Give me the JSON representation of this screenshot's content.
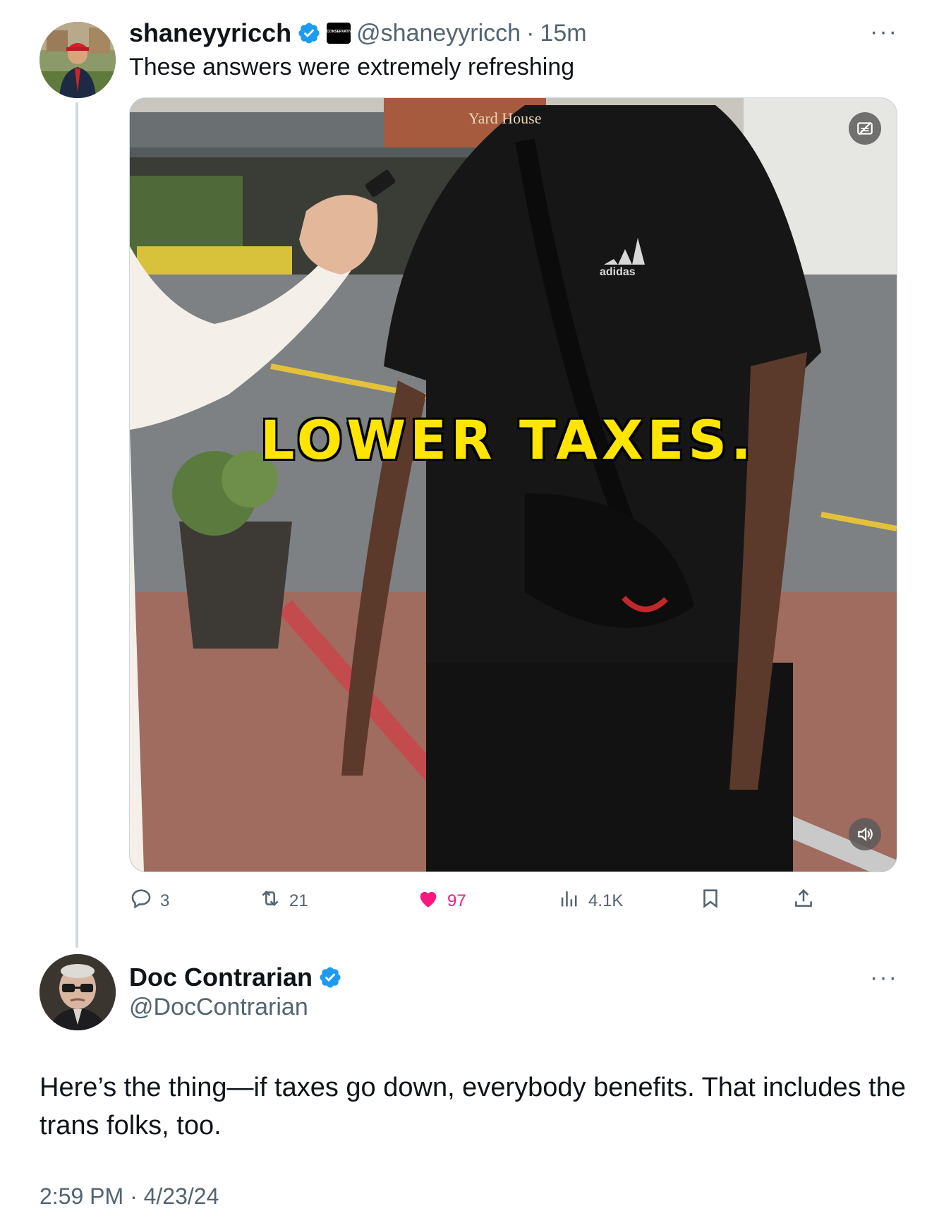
{
  "tweet": {
    "display_name": "shaneyyricch",
    "handle": "@shaneyyricch",
    "separator": "·",
    "time": "15m",
    "affiliation_badge_text": "CONSERVATIVE",
    "text": "These answers were extremely refreshing",
    "media": {
      "caption": "LOWER TAXES.",
      "store_sign": "Yard House",
      "shirt_logo": "adidas"
    },
    "actions": {
      "replies": "3",
      "retweets": "21",
      "likes": "97",
      "views": "4.1K"
    },
    "more": "···"
  },
  "reply": {
    "display_name": "Doc Contrarian",
    "handle": "@DocContrarian",
    "more": "···",
    "text": "Here’s the thing—if taxes go down, everybody benefits. That includes the trans folks, too.",
    "timestamp": "2:59 PM · 4/23/24"
  },
  "colors": {
    "verified": "#1d9bf0",
    "like": "#f91880",
    "secondary_text": "#536471",
    "thread_line": "#cfd9de",
    "caption_yellow": "#ffe500"
  }
}
